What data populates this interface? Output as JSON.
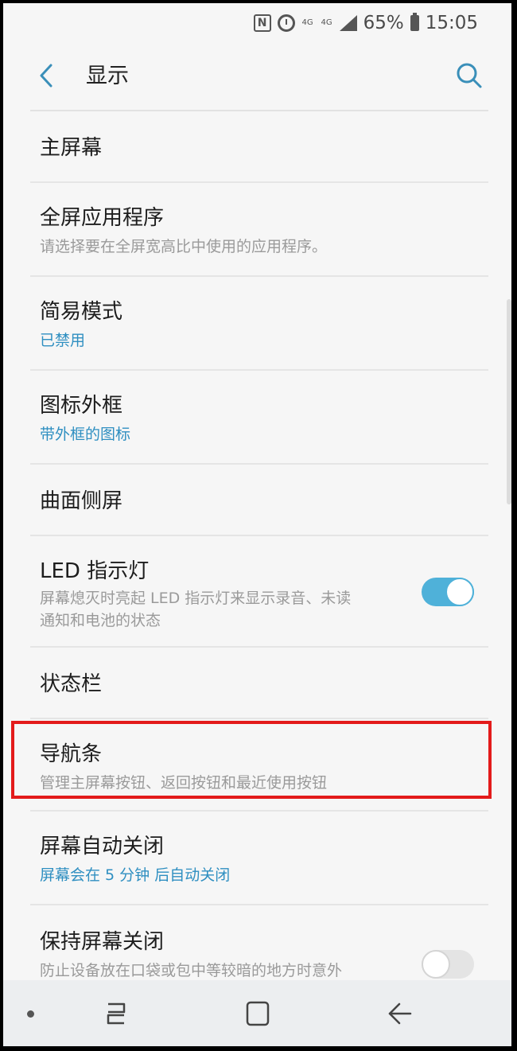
{
  "status_bar": {
    "nfc_icon": "N",
    "net_label": "4G",
    "battery": "65%",
    "time": "15:05"
  },
  "header": {
    "title": "显示"
  },
  "settings": [
    {
      "title": "主屏幕"
    },
    {
      "title": "全屏应用程序",
      "subtitle": "请选择要在全屏宽高比中使用的应用程序。"
    },
    {
      "title": "简易模式",
      "subtitle": "已禁用"
    },
    {
      "title": "图标外框",
      "subtitle": "带外框的图标"
    },
    {
      "title": "曲面侧屏"
    },
    {
      "title": "LED 指示灯",
      "subtitle_line1": "屏幕熄灭时亮起 LED 指示灯来显示录音、未读",
      "subtitle_line2": "通知和电池的状态",
      "toggle": "on"
    },
    {
      "title": "状态栏"
    },
    {
      "title": "导航条",
      "subtitle": "管理主屏幕按钮、返回按钮和最近使用按钮"
    },
    {
      "title": "屏幕自动关闭",
      "subtitle": "屏幕会在 5 分钟 后自动关闭"
    },
    {
      "title": "保持屏幕关闭",
      "subtitle": "防止设备放在口袋或包中等较暗的地方时意外",
      "toggle": "off"
    }
  ],
  "colors": {
    "accent": "#4fb1d9",
    "link_text": "#2f8fc1",
    "highlight_border": "#e31b1b"
  }
}
